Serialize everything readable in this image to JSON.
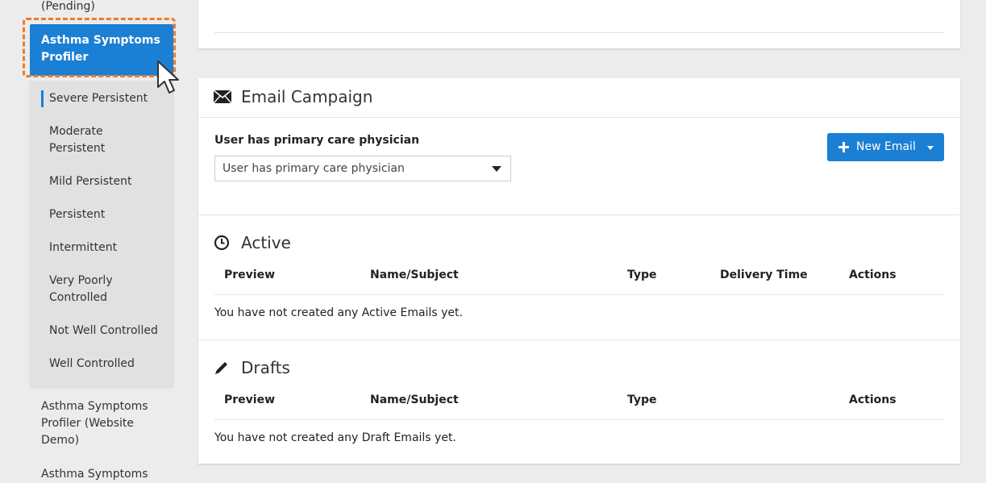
{
  "sidebar": {
    "pending_label": "(Pending)",
    "active_item": "Asthma Symptoms Profiler",
    "sub_items": [
      "Severe Persistent",
      "Moderate Persistent",
      "Mild Persistent",
      "Persistent",
      "Intermittent",
      "Very Poorly Controlled",
      "Not Well Controlled",
      "Well Controlled"
    ],
    "other_items": [
      "Asthma Symptoms Profiler (Website Demo)",
      "Asthma Symptoms"
    ]
  },
  "campaign": {
    "title": "Email Campaign",
    "icon": "envelope-icon",
    "filter_label": "User has primary care physician",
    "filter_selected": "User has primary care physician",
    "new_email_label": "New Email"
  },
  "active": {
    "title": "Active",
    "icon": "clock-icon",
    "columns": [
      "Preview",
      "Name/Subject",
      "Type",
      "Delivery Time",
      "Actions"
    ],
    "empty_text": "You have not created any Active Emails yet."
  },
  "drafts": {
    "title": "Drafts",
    "icon": "pencil-icon",
    "columns": [
      "Preview",
      "Name/Subject",
      "Type",
      "Actions"
    ],
    "empty_text": "You have not created any Draft Emails yet."
  },
  "colors": {
    "accent": "#1b7fd4",
    "highlight": "#ef7a2a"
  }
}
